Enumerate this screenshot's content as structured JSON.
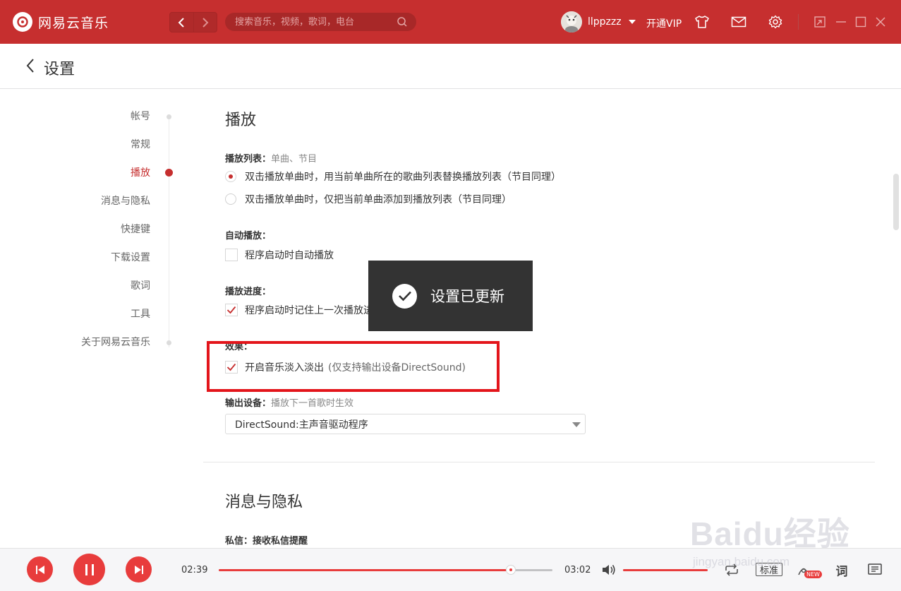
{
  "app": {
    "name": "网易云音乐"
  },
  "search": {
    "placeholder": "搜索音乐，视频，歌词，电台"
  },
  "user": {
    "name": "llppzzz",
    "vip_label": "开通VIP"
  },
  "page": {
    "title": "设置"
  },
  "sidenav": {
    "items": [
      {
        "label": "帐号",
        "active": false
      },
      {
        "label": "常规",
        "active": false
      },
      {
        "label": "播放",
        "active": true
      },
      {
        "label": "消息与隐私",
        "active": false
      },
      {
        "label": "快捷键",
        "active": false
      },
      {
        "label": "下载设置",
        "active": false
      },
      {
        "label": "歌词",
        "active": false
      },
      {
        "label": "工具",
        "active": false
      },
      {
        "label": "关于网易云音乐",
        "active": false
      }
    ]
  },
  "playback": {
    "section_title": "播放",
    "playlist": {
      "label": "播放列表：",
      "sub": "单曲、节目",
      "options": [
        {
          "label": "双击播放单曲时，用当前单曲所在的歌曲列表替换播放列表（节目同理）",
          "selected": true
        },
        {
          "label": "双击播放单曲时，仅把当前单曲添加到播放列表（节目同理）",
          "selected": false
        }
      ]
    },
    "autoplay": {
      "label": "自动播放：",
      "option": "程序启动时自动播放",
      "checked": false
    },
    "progress": {
      "label": "播放进度：",
      "option": "程序启动时记住上一次播放进度",
      "checked": true
    },
    "effect": {
      "label": "效果：",
      "option": "开启音乐淡入淡出",
      "note": "(仅支持输出设备DirectSound)",
      "checked": true
    },
    "output": {
      "label": "输出设备：",
      "sub": "播放下一首歌时生效",
      "selected": "DirectSound:主声音驱动程序"
    }
  },
  "privacy": {
    "section_title": "消息与隐私",
    "dm_label": "私信：",
    "dm_sub": "接收私信提醒"
  },
  "toast": {
    "text": "设置已更新"
  },
  "player": {
    "current_time": "02:39",
    "total_time": "03:02",
    "progress_fraction": 0.875,
    "volume_fraction": 1.0,
    "quality": "标准",
    "new_badge": "NEW",
    "lyric_label": "词"
  },
  "watermark": {
    "logo": "Baidu经验",
    "url": "jingyan.baidu.com"
  },
  "colors": {
    "accent": "#c62f2f",
    "player_accent": "#e83c3c",
    "highlight": "#e3151b"
  }
}
